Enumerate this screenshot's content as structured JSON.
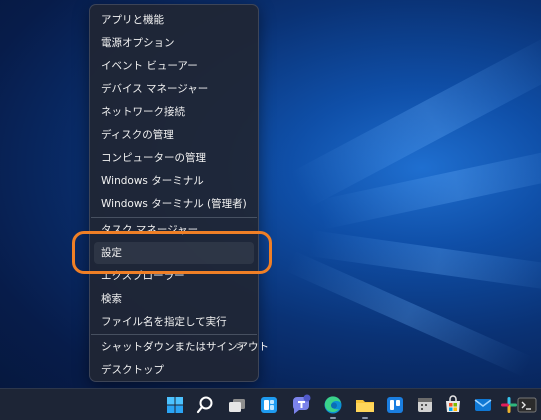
{
  "context_menu": {
    "items": [
      {
        "label": "アプリと機能"
      },
      {
        "label": "電源オプション"
      },
      {
        "label": "イベント ビューアー"
      },
      {
        "label": "デバイス マネージャー"
      },
      {
        "label": "ネットワーク接続"
      },
      {
        "label": "ディスクの管理"
      },
      {
        "label": "コンピューターの管理"
      },
      {
        "label": "Windows ターミナル"
      },
      {
        "label": "Windows ターミナル (管理者)"
      },
      {
        "label": "タスク マネージャー"
      },
      {
        "label": "設定",
        "highlighted": true
      },
      {
        "label": "エクスプローラー"
      },
      {
        "label": "検索"
      },
      {
        "label": "ファイル名を指定して実行"
      },
      {
        "label": "シャットダウンまたはサインアウト",
        "submenu_indicator": ">"
      },
      {
        "label": "デスクトップ"
      }
    ]
  },
  "annotation": {
    "color": "#ef7f26",
    "target": "設定"
  },
  "taskbar": {
    "icons": [
      "windows-start-icon",
      "search-icon",
      "task-view-icon",
      "widgets-icon",
      "teams-chat-icon",
      "edge-icon",
      "file-explorer-icon",
      "trello-icon",
      "calendar-icon",
      "store-icon",
      "mail-icon",
      "slack-icon",
      "terminal-icon"
    ]
  },
  "colors": {
    "accent": "#ef7f26",
    "menu_bg": "#202634",
    "taskbar_bg": "#1d2536"
  }
}
